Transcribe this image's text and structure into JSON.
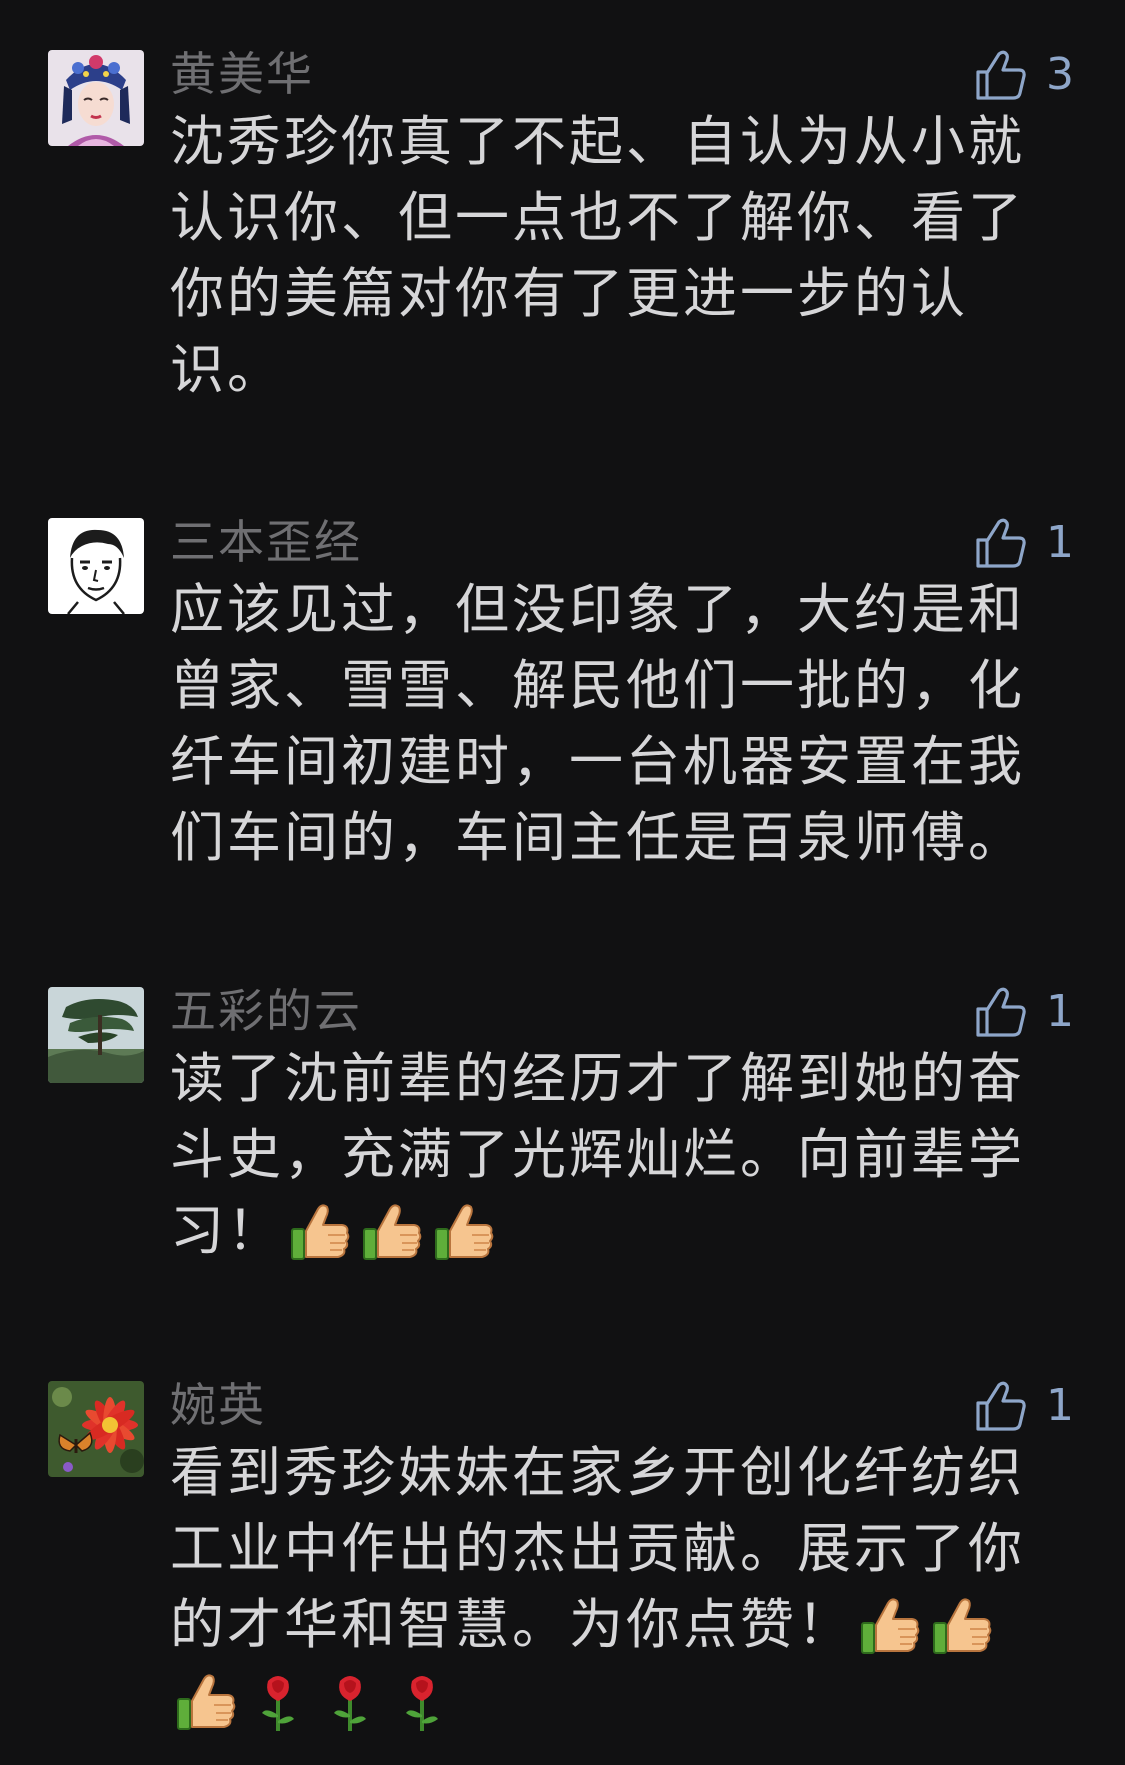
{
  "colors": {
    "background": "#111112",
    "author": "#6f6f72",
    "text": "#d6d6d8",
    "like_accent": "#8ea6c9"
  },
  "comments": [
    {
      "author": "黄美华",
      "likes": "3",
      "text": "沈秀珍你真了不起、自认为从小就认识你、但一点也不了解你、看了你的美篇对你有了更进一步的认识。",
      "avatar_icon": "opera-headdress-portrait",
      "emojis": []
    },
    {
      "author": "三本歪经",
      "likes": "1",
      "text": "应该见过，但没印象了，大约是和曾家、雪雪、解民他们一批的，化纤车间初建时，一台机器安置在我们车间的，车间主任是百泉师傅。",
      "avatar_icon": "sketch-face-portrait",
      "emojis": []
    },
    {
      "author": "五彩的云",
      "likes": "1",
      "text": "读了沈前辈的经历才了解到她的奋斗史，充满了光辉灿烂。向前辈学习！",
      "avatar_icon": "pine-tree-landscape",
      "emojis": [
        "thumbs-up-emoji",
        "thumbs-up-emoji",
        "thumbs-up-emoji"
      ]
    },
    {
      "author": "婉英",
      "likes": "1",
      "text": "看到秀珍妹妹在家乡开创化纤纺织工业中作出的杰出贡献。展示了你的才华和智慧。为你点赞！",
      "avatar_icon": "red-flower-butterfly",
      "emojis": [
        "thumbs-up-emoji",
        "thumbs-up-emoji",
        "thumbs-up-emoji",
        "rose-emoji",
        "rose-emoji",
        "rose-emoji"
      ]
    }
  ]
}
